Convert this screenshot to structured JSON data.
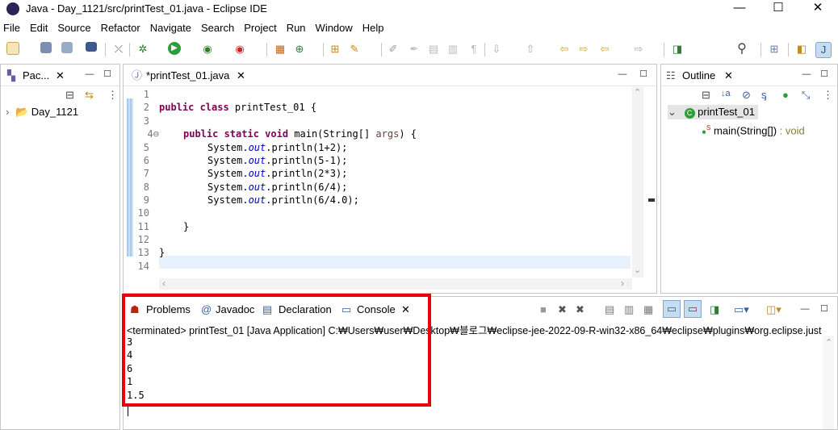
{
  "window": {
    "title": "Java - Day_1121/src/printTest_01.java - Eclipse IDE",
    "min": "—",
    "max": "☐",
    "close": "✕"
  },
  "menu": [
    "File",
    "Edit",
    "Source",
    "Refactor",
    "Navigate",
    "Search",
    "Project",
    "Run",
    "Window",
    "Help"
  ],
  "package_explorer": {
    "tab_label": "Pac...",
    "project": "Day_1121"
  },
  "editor": {
    "tab_label": "*printTest_01.java",
    "line_numbers": [
      "1",
      "2",
      "3",
      "4⊖",
      "5",
      "6",
      "7",
      "8",
      "9",
      "10",
      "11",
      "12",
      "13",
      "14"
    ],
    "lines": {
      "l2_kw": "public class",
      "l2_rest": " printTest_01 {",
      "l4_kw": "public static void",
      "l4_mid": " main(String[] ",
      "l4_param": "args",
      "l4_end": ") {",
      "sys": "System.",
      "out": "out",
      "l5_rest": ".println(1+2);",
      "l6_rest": ".println(5-1);",
      "l7_rest": ".println(2*3);",
      "l8_rest": ".println(6/4);",
      "l9_rest": ".println(6/4.0);",
      "l11": "}",
      "l13": "}"
    }
  },
  "outline": {
    "tab_label": "Outline",
    "class_name": "printTest_01",
    "method_name": "main(String[])",
    "method_type": " : void"
  },
  "bottom": {
    "tabs": {
      "problems": "Problems",
      "javadoc": "Javadoc",
      "declaration": "Declaration",
      "console": "Console"
    },
    "console_header": "<terminated> printTest_01 [Java Application] C:₩Users₩user₩Desktop₩블로그₩eclipse-jee-2022-09-R-win32-x86_64₩eclipse₩plugins₩org.eclipse.just",
    "output": [
      "3",
      "4",
      "6",
      "1",
      "1.5"
    ]
  },
  "colors": {
    "highlight": "#e8000d",
    "keyword": "#7f0055",
    "field": "#0000c0"
  }
}
